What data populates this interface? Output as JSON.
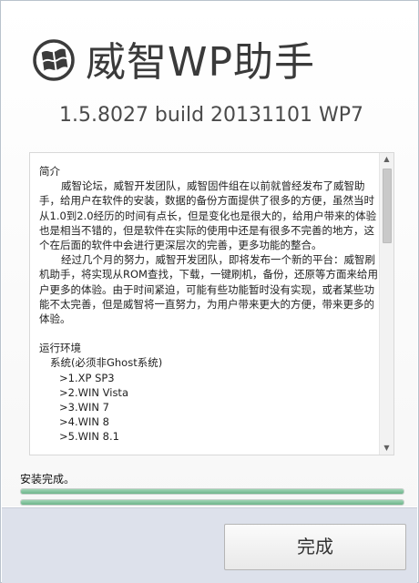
{
  "header": {
    "app_title": "威智WP助手",
    "version": "1.5.8027 build 20131101 WP7",
    "logo_icon": "windows-phone-logo-icon"
  },
  "intro": {
    "heading": "简介",
    "para1": "威智论坛，威智开发团队，威智固件组在以前就曾经发布了威智助手，给用户在软件的安装，数据的备份方面提供了很多的方便，虽然当时从1.0到2.0经历的时间有点长，但是变化也是很大的，给用户带来的体验也是相当不错的，但是软件在实际的使用中还是有很多不完善的地方，这个在后面的软件中会进行更深层次的完善，更多功能的整合。",
    "para2": "经过几个月的努力，威智开发团队，即将发布一个新的平台：威智刷机助手，将实现从ROM查找，下载，一键刷机，备份，还原等方面来给用户更多的体验。由于时间紧迫，可能有些功能暂时没有实现，或者某些功能不太完善，但是威智将一直努力，为用户带来更大的方便，带来更多的体验。"
  },
  "requirements": {
    "heading": "运行环境",
    "system_label": "系统(必须非Ghost系统)",
    "systems": [
      ">1.XP SP3",
      ">2.WIN Vista",
      ">3.WIN 7",
      ">4.WIN 8",
      ">5.WIN 8.1"
    ]
  },
  "status": {
    "text": "安装完成。",
    "progress_bars": [
      1.0,
      1.0
    ]
  },
  "footer": {
    "finish_label": "完成"
  },
  "colors": {
    "progress_fill": "#7cc398",
    "bottom_bar": "#dde1eb"
  }
}
